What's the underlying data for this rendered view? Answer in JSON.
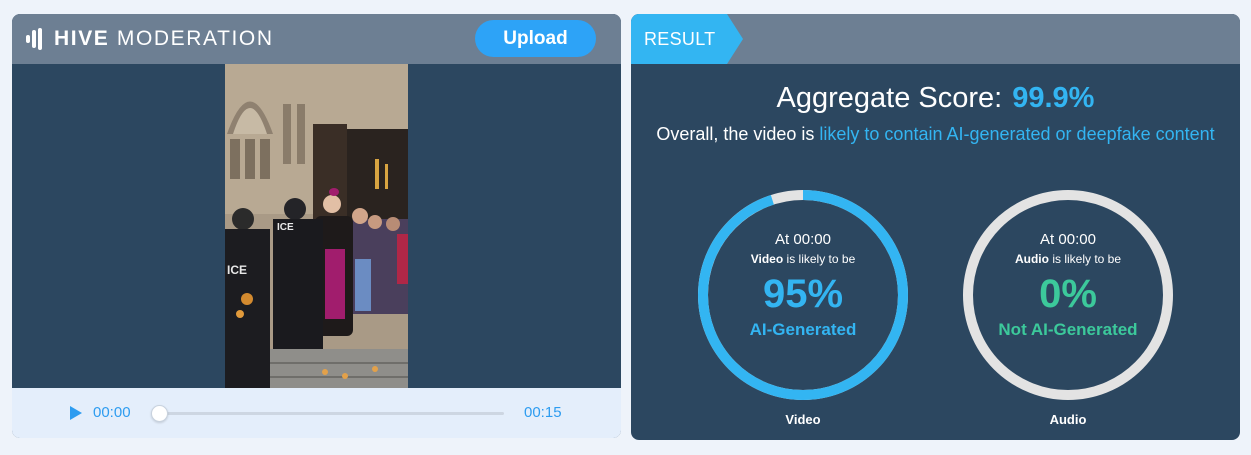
{
  "header": {
    "brand_bold": "HIVE",
    "brand_light": "MODERATION",
    "upload_label": "Upload"
  },
  "player": {
    "current_time": "00:00",
    "duration": "00:15",
    "progress_fraction": 0
  },
  "result": {
    "tab_label": "RESULT",
    "aggregate_label": "Aggregate Score:",
    "aggregate_value": "99.9%",
    "overall_prefix": "Overall, the video is",
    "overall_highlight": "likely to contain AI-generated or deepfake content",
    "gauges": [
      {
        "at": "At 00:00",
        "subject": "Video",
        "likely": "is likely to be",
        "percent": "95%",
        "verdict": "AI-Generated",
        "caption": "Video",
        "fill_fraction": 0.95,
        "color": "#33b5f2"
      },
      {
        "at": "At 00:00",
        "subject": "Audio",
        "likely": "is likely to be",
        "percent": "0%",
        "verdict": "Not AI-Generated",
        "caption": "Audio",
        "fill_fraction": 0,
        "color": "#3cc99b"
      }
    ]
  },
  "colors": {
    "accent_blue": "#33b5f2",
    "accent_green": "#3cc99b",
    "panel_dark": "#2c4760",
    "header_gray": "#6d7f93"
  }
}
